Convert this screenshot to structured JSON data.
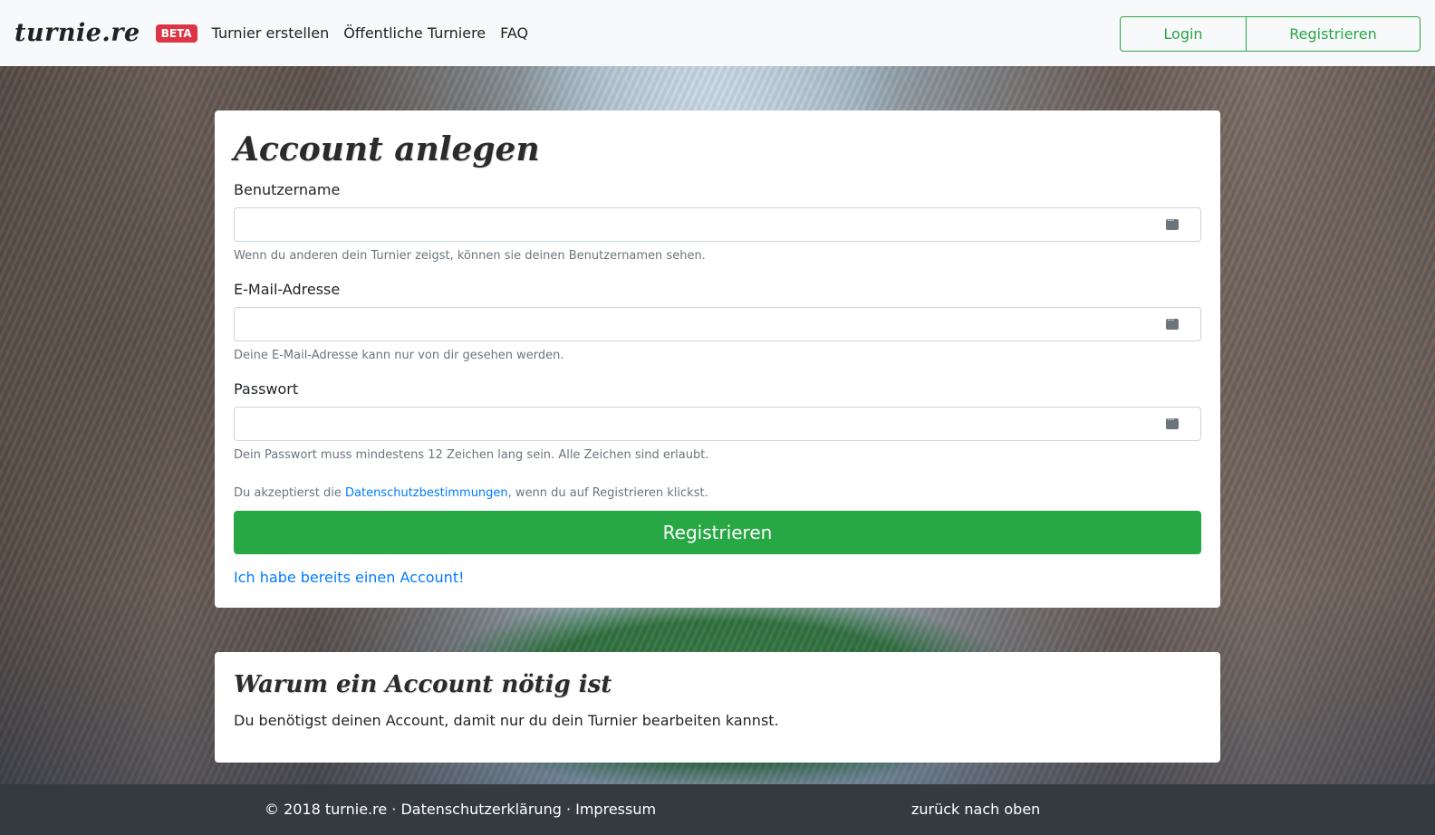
{
  "navbar": {
    "brand": "turnie.re",
    "badge": "BETA",
    "links": [
      "Turnier erstellen",
      "Öffentliche Turniere",
      "FAQ"
    ],
    "login": "Login",
    "register": "Registrieren"
  },
  "form": {
    "title": "Account anlegen",
    "fields": [
      {
        "label": "Benutzername",
        "value": "",
        "help": "Wenn du anderen dein Turnier zeigst, können sie deinen Benutzernamen sehen."
      },
      {
        "label": "E-Mail-Adresse",
        "value": "",
        "help": "Deine E-Mail-Adresse kann nur von dir gesehen werden."
      },
      {
        "label": "Passwort",
        "value": "",
        "help": "Dein Passwort muss mindestens 12 Zeichen lang sein. Alle Zeichen sind erlaubt."
      }
    ],
    "consent_prefix": "Du akzeptierst die ",
    "consent_link": "Datenschutzbestimmungen",
    "consent_suffix": ", wenn du auf Registrieren klickst.",
    "submit": "Registrieren",
    "have_account": "Ich habe bereits einen Account!"
  },
  "info": {
    "title": "Warum ein Account nötig ist",
    "text": "Du benötigst deinen Account, damit nur du dein Turnier bearbeiten kannst."
  },
  "footer": {
    "left": "© 2018 turnie.re · Datenschutzerklärung · Impressum",
    "right": "zurück nach oben"
  },
  "colors": {
    "accent_green": "#28a745",
    "link_blue": "#007bff",
    "badge_red": "#dc3545",
    "footer_bg": "#343a40"
  }
}
